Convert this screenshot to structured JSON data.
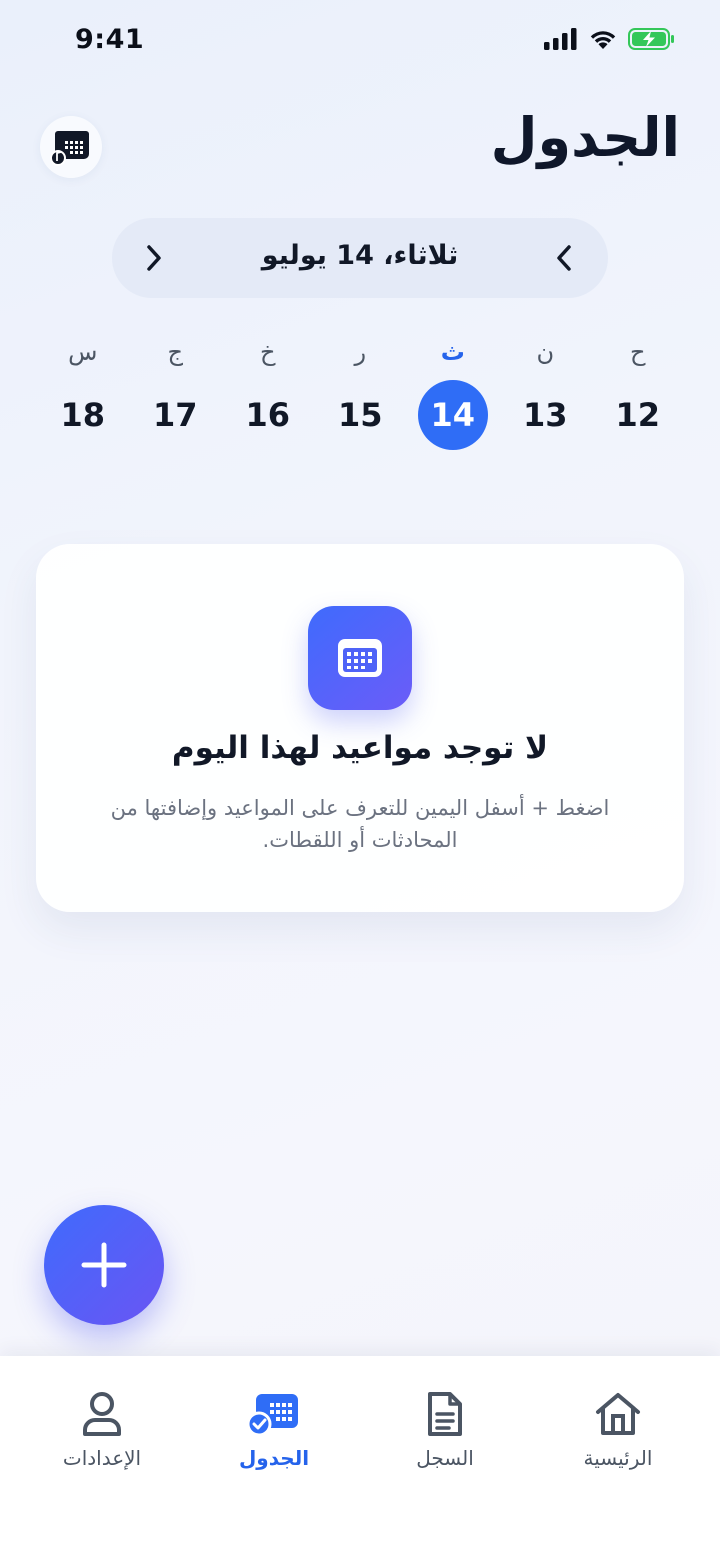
{
  "status_bar": {
    "time": "9:41"
  },
  "header": {
    "title": "الجدول",
    "calendar_button_icon": "calendar-music-icon"
  },
  "date_nav": {
    "label": "ثلاثاء، 14 يوليو",
    "prev_icon": "chevron-right-icon",
    "next_icon": "chevron-left-icon"
  },
  "week": {
    "days": [
      {
        "weekday": "ح",
        "date": "12"
      },
      {
        "weekday": "ن",
        "date": "13"
      },
      {
        "weekday": "ث",
        "date": "14",
        "selected": true
      },
      {
        "weekday": "ر",
        "date": "15"
      },
      {
        "weekday": "خ",
        "date": "16"
      },
      {
        "weekday": "ج",
        "date": "17"
      },
      {
        "weekday": "س",
        "date": "18"
      }
    ]
  },
  "empty_state": {
    "icon": "calendar-icon",
    "title": "لا توجد مواعيد لهذا اليوم",
    "description": "اضغط + أسفل اليمين للتعرف على المواعيد وإضافتها من المحادثات أو اللقطات."
  },
  "fab": {
    "icon": "plus-icon"
  },
  "tabbar": {
    "tabs": [
      {
        "label": "الرئيسية",
        "icon": "home-icon"
      },
      {
        "label": "السجل",
        "icon": "document-icon"
      },
      {
        "label": "الجدول",
        "icon": "calendar-check-icon",
        "active": true
      },
      {
        "label": "الإعدادات",
        "icon": "user-icon"
      }
    ]
  },
  "colors": {
    "accent": "#2f6df6",
    "gradient_start": "#3f6bfd",
    "gradient_end": "#6a55f3"
  }
}
